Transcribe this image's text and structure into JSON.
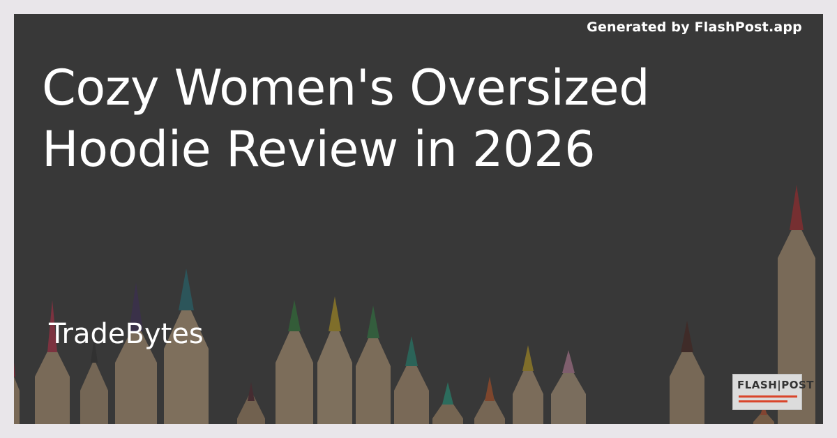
{
  "badge": {
    "generated_text": "Generated by FlashPost.app"
  },
  "post": {
    "title": "Cozy Women's Oversized Hoodie Review in 2026",
    "author": "TradeBytes"
  },
  "logo": {
    "text": "FLASH|POST",
    "accent_color": "#d9452b"
  },
  "background": {
    "image": "colored-pencils"
  },
  "colors": {
    "overlay": "#3a3a3a",
    "text": "#ffffff",
    "page": "#e9e6ea"
  }
}
